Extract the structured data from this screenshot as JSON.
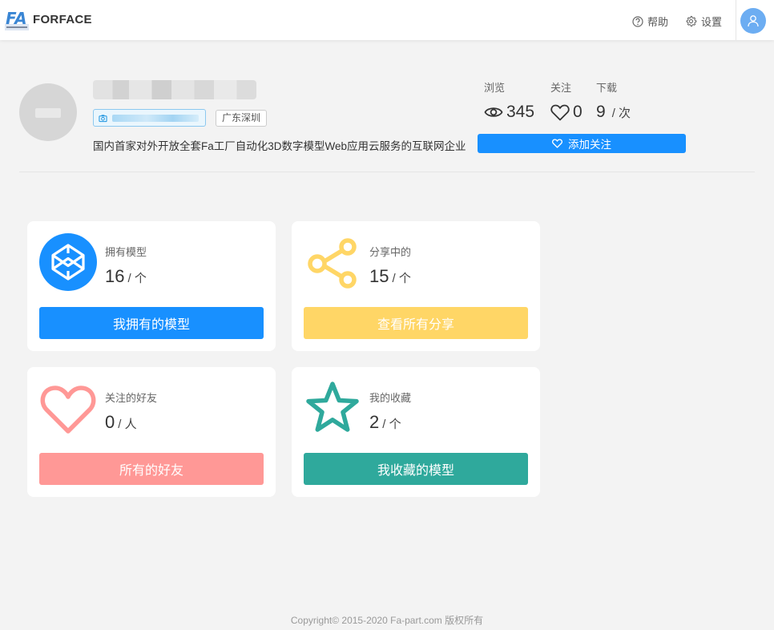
{
  "header": {
    "brand": "FORFACE",
    "help_label": "帮助",
    "settings_label": "设置"
  },
  "profile": {
    "city": "广东深圳",
    "description": "国内首家对外开放全套Fa工厂自动化3D数字模型Web应用云服务的互联网企业",
    "follow_button": "添加关注"
  },
  "stats": {
    "views_label": "浏览",
    "views": "345",
    "follows_label": "关注",
    "follows": "0",
    "downloads_label": "下载",
    "downloads": "9",
    "downloads_unit": "/ 次"
  },
  "cards": [
    {
      "label": "拥有模型",
      "value": "16",
      "unit": "/ 个",
      "button": "我拥有的模型",
      "color": "#1890ff",
      "icon": "codepen-cube-icon"
    },
    {
      "label": "分享中的",
      "value": "15",
      "unit": "/ 个",
      "button": "查看所有分享",
      "color": "#ffd666",
      "icon": "share-icon"
    },
    {
      "label": "关注的好友",
      "value": "0",
      "unit": "/ 人",
      "button": "所有的好友",
      "color": "#ff9896",
      "icon": "heart-icon"
    },
    {
      "label": "我的收藏",
      "value": "2",
      "unit": "/ 个",
      "button": "我收藏的模型",
      "color": "#2fa99c",
      "icon": "star-icon"
    }
  ],
  "footer": {
    "copyright": "Copyright© 2015-2020 Fa-part.com 版权所有"
  }
}
